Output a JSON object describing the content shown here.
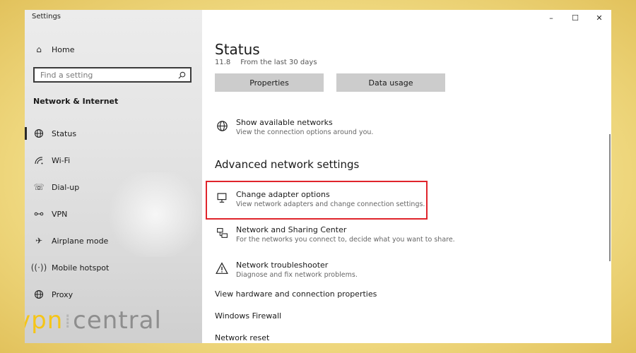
{
  "window": {
    "title": "Settings",
    "controls": {
      "minimize": "–",
      "maximize": "☐",
      "close": "✕"
    }
  },
  "sidebar": {
    "home_label": "Home",
    "search_placeholder": "Find a setting",
    "section_heading": "Network & Internet",
    "items": [
      {
        "label": "Status",
        "icon": "globe-icon",
        "selected": true
      },
      {
        "label": "Wi-Fi",
        "icon": "wifi-icon"
      },
      {
        "label": "Dial-up",
        "icon": "phone-icon"
      },
      {
        "label": "VPN",
        "icon": "vpn-icon"
      },
      {
        "label": "Airplane mode",
        "icon": "airplane-icon"
      },
      {
        "label": "Mobile hotspot",
        "icon": "hotspot-icon"
      },
      {
        "label": "Proxy",
        "icon": "globe-icon"
      }
    ]
  },
  "content": {
    "page_title": "Status",
    "data_usage_value": "11.8",
    "data_usage_period": "From the last 30 days",
    "buttons": {
      "properties": "Properties",
      "data_usage": "Data usage"
    },
    "show_networks": {
      "title": "Show available networks",
      "subtitle": "View the connection options around you."
    },
    "advanced_heading": "Advanced network settings",
    "adapter": {
      "title": "Change adapter options",
      "subtitle": "View network adapters and change connection settings."
    },
    "sharing": {
      "title": "Network and Sharing Center",
      "subtitle": "For the networks you connect to, decide what you want to share."
    },
    "troubleshooter": {
      "title": "Network troubleshooter",
      "subtitle": "Diagnose and fix network problems."
    },
    "links": {
      "hardware": "View hardware and connection properties",
      "firewall": "Windows Firewall",
      "reset": "Network reset"
    }
  },
  "watermark": {
    "left": "vpn",
    "right": "central"
  },
  "colors": {
    "highlight": "#e0242b",
    "watermark_yellow": "#f5c518",
    "button_bg": "#cccccc"
  }
}
